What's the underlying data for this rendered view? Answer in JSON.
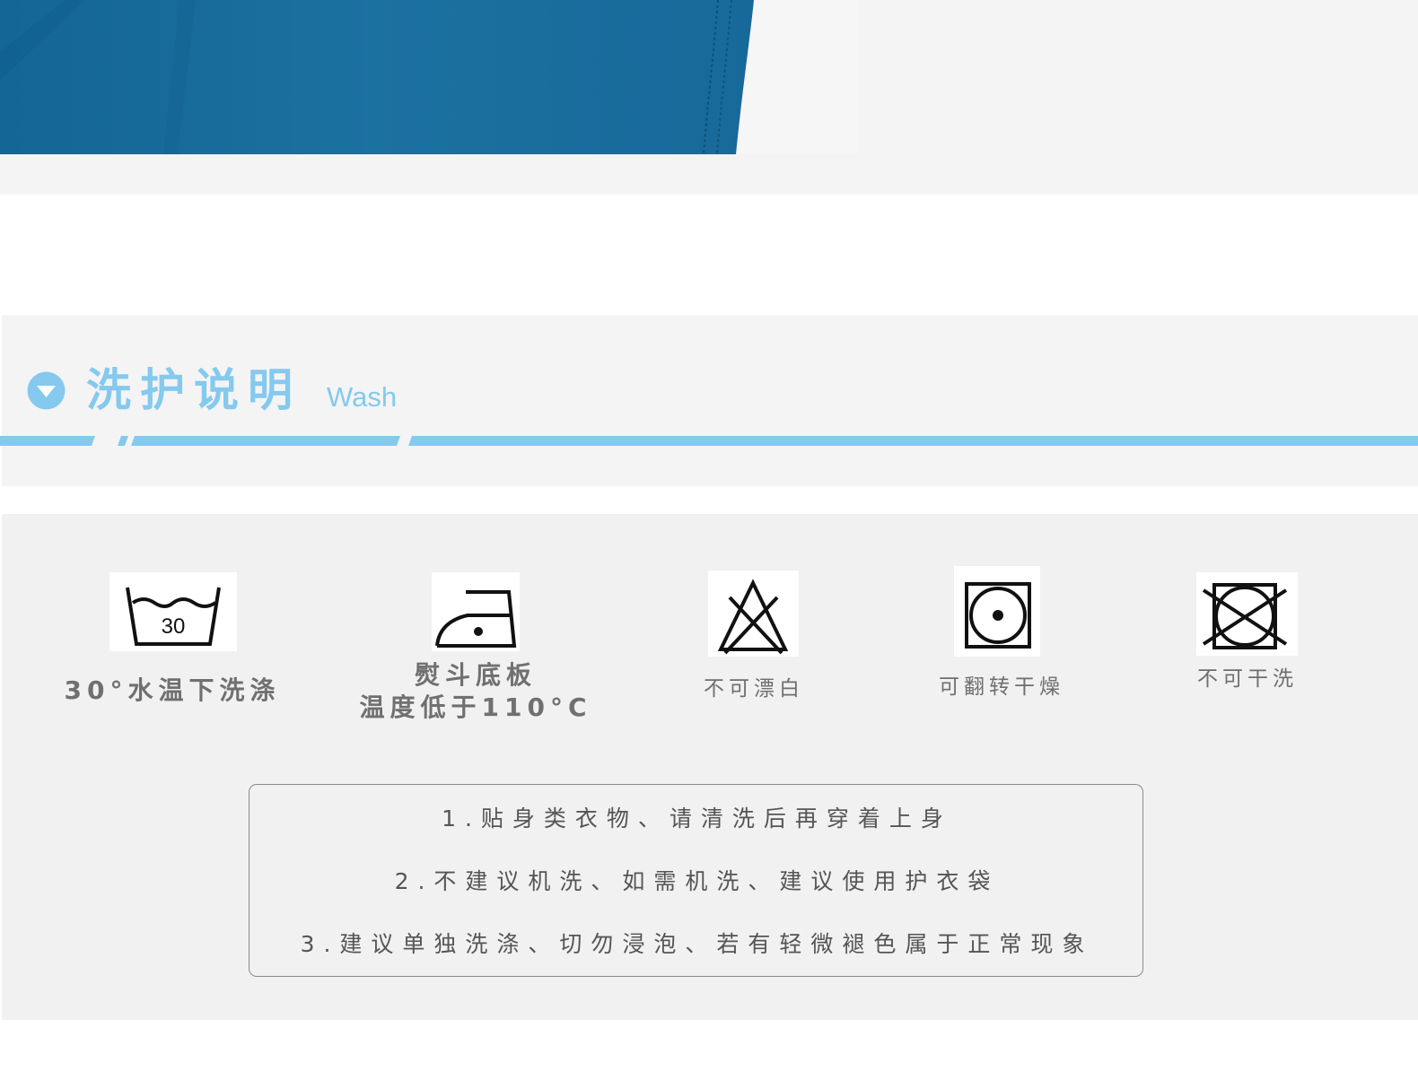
{
  "section": {
    "title": "洗护说明",
    "subtitle": "Wash"
  },
  "care_symbols": [
    {
      "icon": "wash-30-icon",
      "label": "30°水温下洗涤"
    },
    {
      "icon": "iron-low-temp-icon",
      "label": "熨斗底板\n温度低于110°C"
    },
    {
      "icon": "no-bleach-icon",
      "label": "不可漂白"
    },
    {
      "icon": "tumble-dry-icon",
      "label": "可翻转干燥"
    },
    {
      "icon": "no-dry-clean-icon",
      "label": "不可干洗"
    }
  ],
  "wash_icon_text": "30",
  "notes": [
    "1.贴身类衣物、请清洗后再穿着上身",
    "2.不建议机洗、如需机洗、建议使用护衣袋",
    "3.建议单独洗涤、切勿浸泡、若有轻微褪色属于正常现象"
  ],
  "colors": {
    "accent": "#85c9ee",
    "fabric": "#1a6f9c",
    "panel": "#f1f1f1"
  }
}
